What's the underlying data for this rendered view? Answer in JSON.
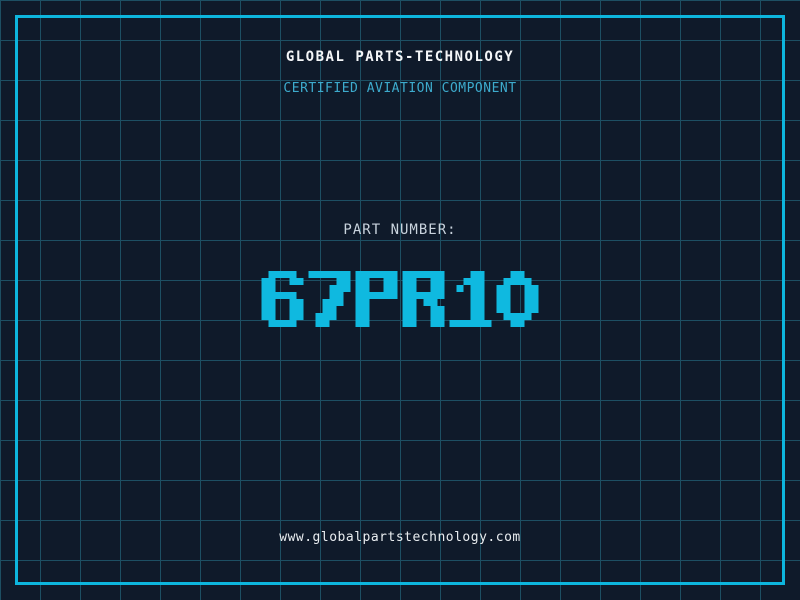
{
  "theme": {
    "background": "#0f1a2a",
    "grid_line": "#1d4f63",
    "border_accent": "#0db5dd",
    "heading_text": "#f4f6f8",
    "subtitle_text": "#3dabcd",
    "label_text": "#c9d3dd",
    "part_number_text": "#0fb9e0",
    "footer_text": "#e9edf0"
  },
  "header": {
    "company_name": "GLOBAL PARTS-TECHNOLOGY",
    "tagline": "CERTIFIED AVIATION COMPONENT"
  },
  "part": {
    "label": "PART NUMBER:",
    "number": "67PR10"
  },
  "footer": {
    "website": "www.globalpartstechnology.com"
  }
}
